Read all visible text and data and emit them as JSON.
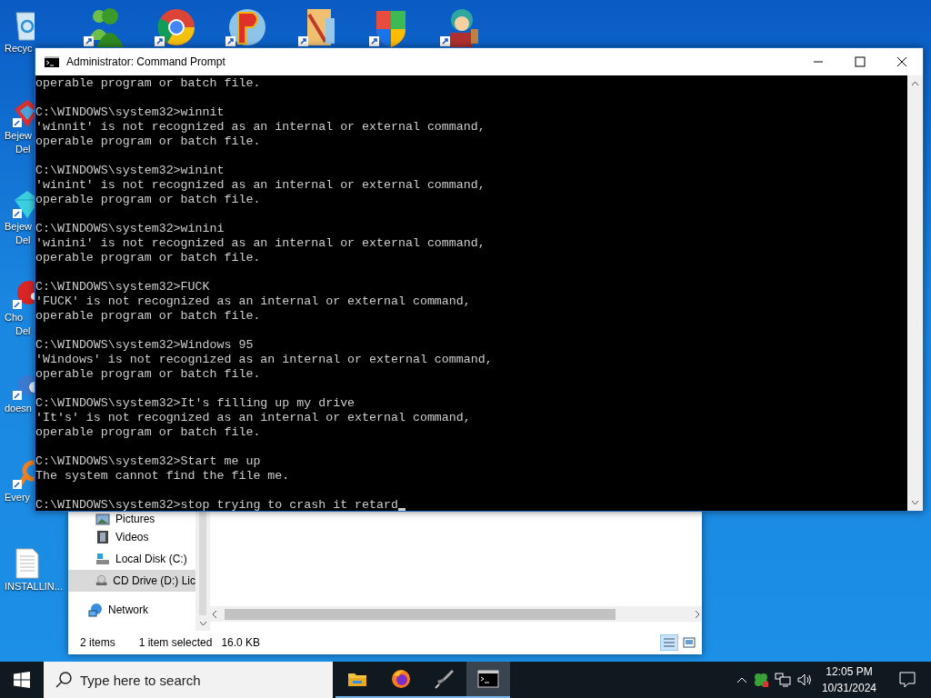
{
  "desktop_icons": [
    {
      "kind": "recycle",
      "lines": [
        "Recyc"
      ]
    },
    {
      "kind": "gem",
      "lines": [
        "Bejew",
        "Del"
      ]
    },
    {
      "kind": "diamond",
      "lines": [
        "Bejew",
        "Del"
      ]
    },
    {
      "kind": "ball",
      "lines": [
        "Cho",
        "Del"
      ]
    },
    {
      "kind": "bird",
      "lines": [
        "doesn"
      ]
    },
    {
      "kind": "orange",
      "lines": [
        "Every"
      ]
    },
    {
      "kind": "document",
      "lines": [
        "INSTALLIN..."
      ]
    }
  ],
  "explorer": {
    "nav_items": [
      {
        "kind": "pictures",
        "label": "Pictures",
        "selected": false
      },
      {
        "kind": "videos",
        "label": "Videos",
        "selected": false
      },
      {
        "kind": "disk",
        "label": "Local Disk (C:)",
        "selected": false
      },
      {
        "kind": "cd",
        "label": "CD Drive (D:) Lic",
        "selected": true
      },
      {
        "kind": "network",
        "label": "Network",
        "selected": false
      }
    ],
    "status": [
      "2 items",
      "1 item selected",
      "16.0 KB"
    ]
  },
  "console": {
    "title": "Administrator: Command Prompt",
    "blocks": [
      [
        "operable program or batch file."
      ],
      [
        "C:\\WINDOWS\\system32>winnit",
        "'winnit' is not recognized as an internal or external command,",
        "operable program or batch file."
      ],
      [
        "C:\\WINDOWS\\system32>winint",
        "'winint' is not recognized as an internal or external command,",
        "operable program or batch file."
      ],
      [
        "C:\\WINDOWS\\system32>winini",
        "'winini' is not recognized as an internal or external command,",
        "operable program or batch file."
      ],
      [
        "C:\\WINDOWS\\system32>FUCK",
        "'FUCK' is not recognized as an internal or external command,",
        "operable program or batch file."
      ],
      [
        "C:\\WINDOWS\\system32>Windows 95",
        "'Windows' is not recognized as an internal or external command,",
        "operable program or batch file."
      ],
      [
        "C:\\WINDOWS\\system32>It's filling up my drive",
        "'It's' is not recognized as an internal or external command,",
        "operable program or batch file."
      ],
      [
        "C:\\WINDOWS\\system32>Start me up",
        "The system cannot find the file me."
      ],
      [
        "C:\\WINDOWS\\system32>stop trying to crash it retard"
      ]
    ]
  },
  "taskbar": {
    "search": {
      "placeholder": "Type here to search"
    },
    "apps": [
      {
        "kind": "folder",
        "active": false
      },
      {
        "kind": "firefox",
        "active": false
      },
      {
        "kind": "rocket",
        "active": false
      },
      {
        "kind": "console",
        "active": true
      }
    ],
    "time": "12:05 PM",
    "date": "10/31/2024"
  }
}
